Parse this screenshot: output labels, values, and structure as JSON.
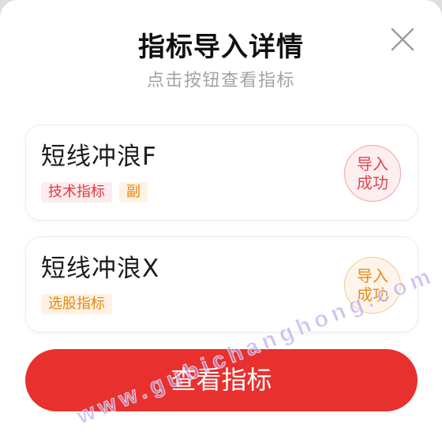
{
  "dialog": {
    "title": "指标导入详情",
    "subtitle": "点击按钮查看指标",
    "close_icon": "close-icon"
  },
  "indicators": [
    {
      "name": "短线冲浪F",
      "tags": [
        {
          "label": "技术指标",
          "text_color": "#e0393d",
          "bg_color": "#fdeced"
        },
        {
          "label": "副",
          "text_color": "#e8880f",
          "bg_color": "#fdf2e3"
        }
      ],
      "status": {
        "label": "导入成功",
        "text_color": "#e0474d",
        "bg_color": "#fdeef0",
        "border_color": "#f2a3a9"
      }
    },
    {
      "name": "短线冲浪X",
      "tags": [
        {
          "label": "选股指标",
          "text_color": "#e8880f",
          "bg_color": "#fdf2e3"
        }
      ],
      "status": {
        "label": "导入成功",
        "text_color": "#e98b1b",
        "bg_color": "#fdf5ea",
        "border_color": "#f6c98f"
      }
    }
  ],
  "primary_button": {
    "label": "查看指标",
    "bg_color": "#e8312f",
    "text_color": "#ffffff"
  },
  "watermark": {
    "text": "www.gubichanghong.com"
  },
  "theme": {
    "title_color": "#111111",
    "subtitle_color": "#a3a3a3",
    "close_icon_color": "#9b9b9b",
    "indicator_name_color": "#1c1c1c",
    "card_border_color": "#ececec"
  }
}
